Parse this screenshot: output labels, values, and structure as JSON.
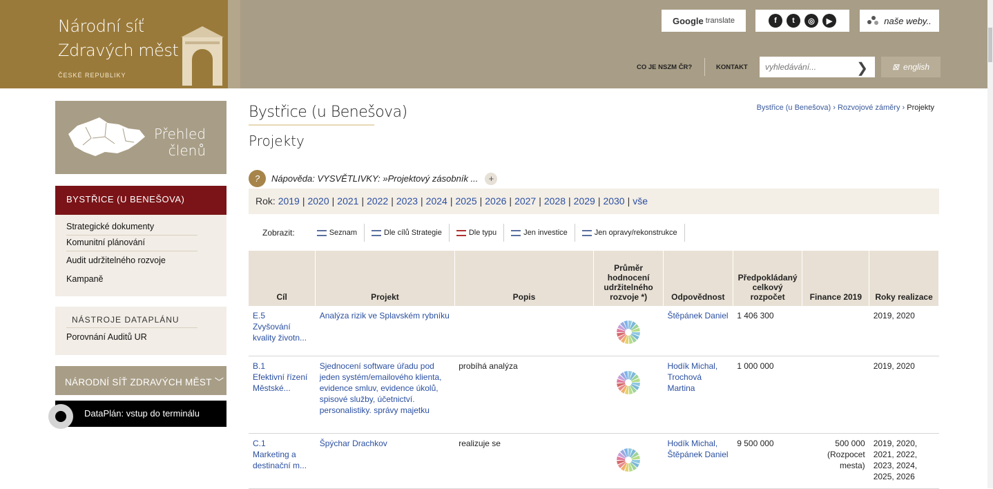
{
  "logo": {
    "line1": "Národní síť",
    "line2": "Zdravých měst",
    "line3": "ČESKÉ REPUBLIKY"
  },
  "header": {
    "google_translate": {
      "brand": "Google",
      "label": "translate"
    },
    "social_icons": [
      "facebook-icon",
      "twitter-icon",
      "instagram-icon",
      "youtube-icon"
    ],
    "nase_weby": "naše weby..",
    "nav": [
      "CO JE NSZM ČR?",
      "KONTAKT"
    ],
    "search_placeholder": "vyhledávání...",
    "english": "english"
  },
  "sidebar": {
    "members": [
      "Přehled",
      "členů"
    ],
    "city_heading": "BYSTŘICE (U BENEŠOVA)",
    "city_items": [
      "Strategické dokumenty",
      "Komunitní plánování",
      "Audit udržitelného rozvoje",
      "Kampaně"
    ],
    "tools_heading": "NÁSTROJE DATAPLÁNU",
    "tools_items": [
      "Porovnání Auditů UR"
    ],
    "nszm": "NÁRODNÍ SÍŤ ZDRAVÝCH MĚST",
    "dataplan": "DataPlán: vstup do terminálu"
  },
  "main": {
    "city_title": "Bystřice (u Benešova)",
    "breadcrumb": [
      "Bystřice (u Benešova)",
      "Rozvojové záměry",
      "Projekty"
    ],
    "page_title": "Projekty",
    "help": "Nápověda: VYSVĚTLIVKY: »Projektový zásobník ...",
    "years_label": "Rok:",
    "years": [
      "2019",
      "2020",
      "2021",
      "2022",
      "2023",
      "2024",
      "2025",
      "2026",
      "2027",
      "2028",
      "2029",
      "2030",
      "vše"
    ],
    "views_label": "Zobrazit:",
    "views": [
      "Seznam",
      "Dle cílů Strategie",
      "Dle typu",
      "Jen investice",
      "Jen opravy/rekonstrukce"
    ],
    "columns": [
      "Cíl",
      "Projekt",
      "Popis",
      "Průměr hodnocení udržitelného rozvoje *)",
      "Odpovědnost",
      "Předpokládaný celkový rozpočet",
      "Finance 2019",
      "Roky realizace"
    ],
    "rows": [
      {
        "cil": "E.5\nZvyšování kvality životn...",
        "projekt": "Analýza rizik ve Splavském rybníku",
        "popis": "",
        "odpovednost": "Štěpánek Daniel",
        "rozpocet": "1 406 300",
        "finance": "",
        "roky": "2019, 2020"
      },
      {
        "cil": "B.1\nEfektivní řízení Městské...",
        "projekt": "Sjednocení software úřadu pod jeden systém/emailového klienta, evidence smluv, evidence úkolů, spisové služby, účetnictví. personalistiky. správy majetku",
        "popis": "probíhá analýza",
        "odpovednost": "Hodík Michal, Trochová Martina",
        "rozpocet": "1 000 000",
        "finance": "",
        "roky": "2019, 2020"
      },
      {
        "cil": "C.1\nMarketing a destinační m...",
        "projekt": "Špýchar Drachkov",
        "popis": "realizuje se",
        "odpovednost": "Hodík Michal, Štěpánek Daniel",
        "rozpocet": "9 500 000",
        "finance": "500 000\n(Rozpocet\nmesta)",
        "roky": "2019, 2020,\n2021, 2022,\n2023, 2024,\n2025, 2026"
      }
    ]
  },
  "colors": {
    "gold": "#9a7a3a",
    "taupe": "#a89d86",
    "burgundy": "#7a1418",
    "link": "#2a4fa0",
    "table_head": "#e8e0d4"
  }
}
